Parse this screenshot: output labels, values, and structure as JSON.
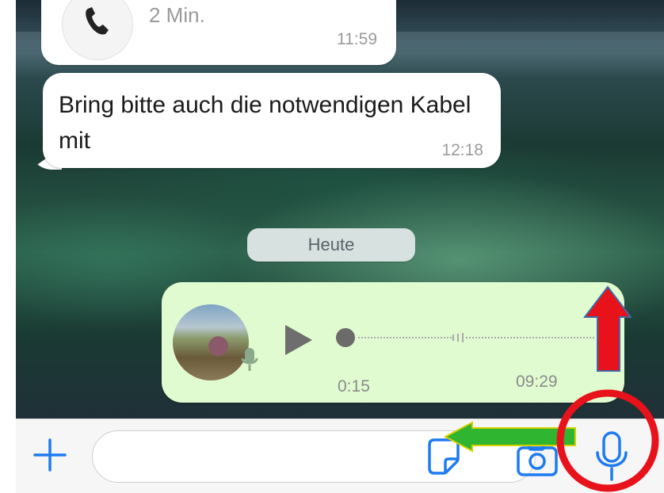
{
  "chat": {
    "call_message": {
      "duration": "2 Min.",
      "time": "11:59"
    },
    "text_message": {
      "text": "Bring bitte auch die notwendigen Kabel mit",
      "time": "12:18"
    },
    "date_separator": "Heute",
    "voice_message": {
      "duration": "0:15",
      "time": "09:29",
      "progress": 0
    }
  },
  "composer": {
    "input_value": "",
    "input_placeholder": ""
  },
  "icons": {
    "call": "phone-handset-icon",
    "play": "play-icon",
    "avatar_mic": "microphone-icon",
    "add": "plus-icon",
    "sticker": "sticker-icon",
    "camera": "camera-icon",
    "mic": "microphone-icon"
  },
  "colors": {
    "outgoing_bubble": "#e1fbd0",
    "incoming_bubble": "#ffffff",
    "accent_blue": "#1e7bf0",
    "annotation_red": "#e8121b",
    "annotation_green": "#2fb52f"
  }
}
